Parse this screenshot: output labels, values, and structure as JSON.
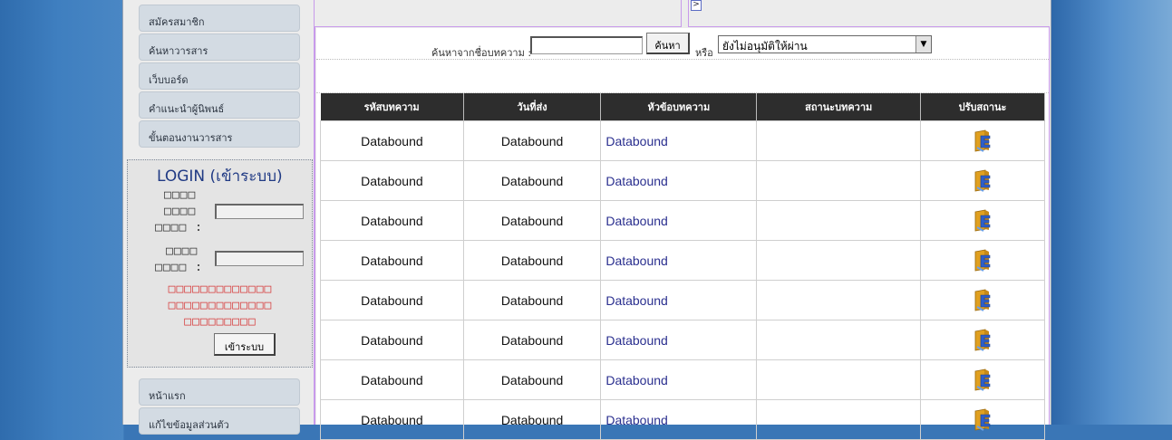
{
  "sidebar": {
    "menu_top": [
      {
        "label": "สมัครสมาชิก"
      },
      {
        "label": "ค้นหาวารสาร"
      },
      {
        "label": "เว็บบอร์ด"
      },
      {
        "label": "คำแนะนำผู้นิพนธ์"
      },
      {
        "label": "ขั้นตอนงานวารสาร"
      }
    ],
    "login": {
      "title": "LOGIN (เข้าระบบ)",
      "label_1a": "□□□□",
      "label_1b": "□□□□",
      "label_1c": "□□□□ :",
      "label_2a": "□□□□",
      "label_2b": "□□□□ :",
      "message": "□□□□□□□□□□□□□ □□□□□□□□□□□□□ □□□□□□□□□",
      "button_label": "เข้าระบบ"
    },
    "menu_bottom": [
      {
        "label": "หน้าแรก"
      },
      {
        "label": "แก้ไขข้อมูลส่วนตัว"
      }
    ]
  },
  "collapse_button": ">",
  "search": {
    "label": "ค้นหาจากชื่อบทความ :",
    "input_value": "",
    "button_label": "ค้นหา",
    "or_label": "หรือ",
    "status_selected": "ยังไม่อนุมัติให้ผ่าน"
  },
  "table": {
    "headers": [
      "รหัสบทความ",
      "วันที่ส่ง",
      "หัวข้อบทความ",
      "สถานะบทความ",
      "ปรับสถานะ"
    ],
    "rows": [
      {
        "id": "Databound",
        "date": "Databound",
        "title": "Databound",
        "status": ""
      },
      {
        "id": "Databound",
        "date": "Databound",
        "title": "Databound",
        "status": ""
      },
      {
        "id": "Databound",
        "date": "Databound",
        "title": "Databound",
        "status": ""
      },
      {
        "id": "Databound",
        "date": "Databound",
        "title": "Databound",
        "status": ""
      },
      {
        "id": "Databound",
        "date": "Databound",
        "title": "Databound",
        "status": ""
      },
      {
        "id": "Databound",
        "date": "Databound",
        "title": "Databound",
        "status": ""
      },
      {
        "id": "Databound",
        "date": "Databound",
        "title": "Databound",
        "status": ""
      },
      {
        "id": "Databound",
        "date": "Databound",
        "title": "Databound",
        "status": ""
      }
    ],
    "action_icon": "edit-document-icon"
  }
}
